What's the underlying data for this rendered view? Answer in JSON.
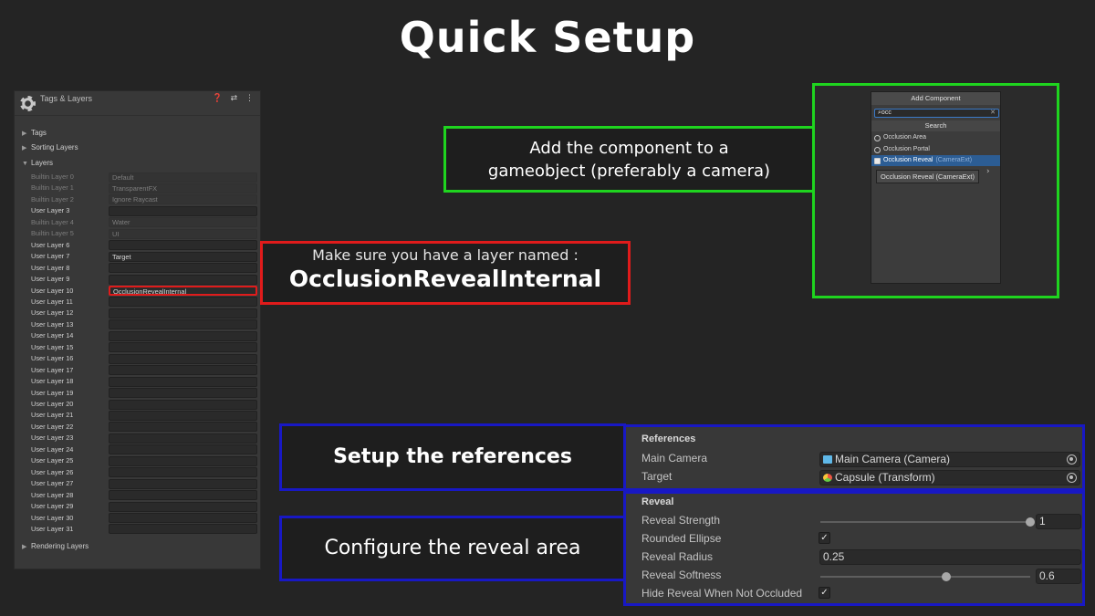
{
  "title": "Quick Setup",
  "tags_layers": {
    "title": "Tags & Layers",
    "header_icons": "❓ ⇄ ⋮",
    "foldouts": {
      "tags": "Tags",
      "sorting_layers": "Sorting Layers",
      "layers": "Layers",
      "rendering_layers": "Rendering Layers"
    },
    "layers": [
      {
        "name": "Builtin Layer 0",
        "value": "Default",
        "builtin": true
      },
      {
        "name": "Builtin Layer 1",
        "value": "TransparentFX",
        "builtin": true
      },
      {
        "name": "Builtin Layer 2",
        "value": "Ignore Raycast",
        "builtin": true
      },
      {
        "name": "User Layer 3",
        "value": "",
        "builtin": false
      },
      {
        "name": "Builtin Layer 4",
        "value": "Water",
        "builtin": true
      },
      {
        "name": "Builtin Layer 5",
        "value": "UI",
        "builtin": true
      },
      {
        "name": "User Layer 6",
        "value": "",
        "builtin": false
      },
      {
        "name": "User Layer 7",
        "value": "Target",
        "builtin": false
      },
      {
        "name": "User Layer 8",
        "value": "",
        "builtin": false
      },
      {
        "name": "User Layer 9",
        "value": "",
        "builtin": false
      },
      {
        "name": "User Layer 10",
        "value": "OcclusionRevealInternal",
        "builtin": false,
        "highlight": true
      },
      {
        "name": "User Layer 11",
        "value": "",
        "builtin": false
      },
      {
        "name": "User Layer 12",
        "value": "",
        "builtin": false
      },
      {
        "name": "User Layer 13",
        "value": "",
        "builtin": false
      },
      {
        "name": "User Layer 14",
        "value": "",
        "builtin": false
      },
      {
        "name": "User Layer 15",
        "value": "",
        "builtin": false
      },
      {
        "name": "User Layer 16",
        "value": "",
        "builtin": false
      },
      {
        "name": "User Layer 17",
        "value": "",
        "builtin": false
      },
      {
        "name": "User Layer 18",
        "value": "",
        "builtin": false
      },
      {
        "name": "User Layer 19",
        "value": "",
        "builtin": false
      },
      {
        "name": "User Layer 20",
        "value": "",
        "builtin": false
      },
      {
        "name": "User Layer 21",
        "value": "",
        "builtin": false
      },
      {
        "name": "User Layer 22",
        "value": "",
        "builtin": false
      },
      {
        "name": "User Layer 23",
        "value": "",
        "builtin": false
      },
      {
        "name": "User Layer 24",
        "value": "",
        "builtin": false
      },
      {
        "name": "User Layer 25",
        "value": "",
        "builtin": false
      },
      {
        "name": "User Layer 26",
        "value": "",
        "builtin": false
      },
      {
        "name": "User Layer 27",
        "value": "",
        "builtin": false
      },
      {
        "name": "User Layer 28",
        "value": "",
        "builtin": false
      },
      {
        "name": "User Layer 29",
        "value": "",
        "builtin": false
      },
      {
        "name": "User Layer 30",
        "value": "",
        "builtin": false
      },
      {
        "name": "User Layer 31",
        "value": "",
        "builtin": false
      }
    ]
  },
  "layer_callout": {
    "line1": "Make sure you have a layer named :",
    "line2": "OcclusionRevealInternal"
  },
  "component_callout": {
    "line1": "Add the component to a",
    "line2": "gameobject (preferably a camera)"
  },
  "add_component": {
    "title": "Add Component",
    "search_value": "occ",
    "section": "Search",
    "items": [
      {
        "label": "Occlusion Area",
        "sub": "",
        "selected": false
      },
      {
        "label": "Occlusion Portal",
        "sub": "",
        "selected": false
      },
      {
        "label": "Occlusion Reveal",
        "sub": "(CameraExt)",
        "selected": true
      }
    ],
    "tooltip": "Occlusion Reveal (CameraExt)"
  },
  "setup_callout": "Setup the references",
  "configure_callout": "Configure the reveal area",
  "references": {
    "header": "References",
    "main_camera_label": "Main Camera",
    "main_camera_value": "Main Camera (Camera)",
    "target_label": "Target",
    "target_value": "Capsule (Transform)"
  },
  "reveal": {
    "header": "Reveal",
    "strength_label": "Reveal Strength",
    "strength_value": "1",
    "strength_fraction": 1.0,
    "rounded_label": "Rounded Ellipse",
    "rounded_checked": true,
    "radius_label": "Reveal Radius",
    "radius_value": "0.25",
    "softness_label": "Reveal Softness",
    "softness_value": "0.6",
    "softness_fraction": 0.6,
    "hide_label": "Hide Reveal When Not Occluded",
    "hide_checked": true,
    "check_glyph": "✓"
  }
}
